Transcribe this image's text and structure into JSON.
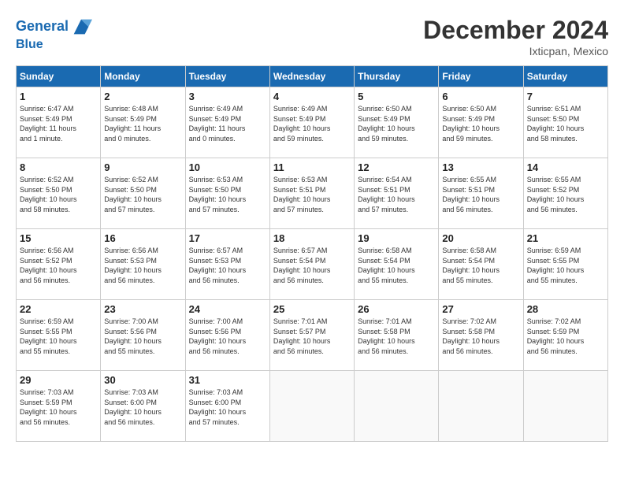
{
  "header": {
    "logo_line1": "General",
    "logo_line2": "Blue",
    "month": "December 2024",
    "location": "Ixticpan, Mexico"
  },
  "days_of_week": [
    "Sunday",
    "Monday",
    "Tuesday",
    "Wednesday",
    "Thursday",
    "Friday",
    "Saturday"
  ],
  "weeks": [
    [
      {
        "day": "1",
        "info": "Sunrise: 6:47 AM\nSunset: 5:49 PM\nDaylight: 11 hours\nand 1 minute."
      },
      {
        "day": "2",
        "info": "Sunrise: 6:48 AM\nSunset: 5:49 PM\nDaylight: 11 hours\nand 0 minutes."
      },
      {
        "day": "3",
        "info": "Sunrise: 6:49 AM\nSunset: 5:49 PM\nDaylight: 11 hours\nand 0 minutes."
      },
      {
        "day": "4",
        "info": "Sunrise: 6:49 AM\nSunset: 5:49 PM\nDaylight: 10 hours\nand 59 minutes."
      },
      {
        "day": "5",
        "info": "Sunrise: 6:50 AM\nSunset: 5:49 PM\nDaylight: 10 hours\nand 59 minutes."
      },
      {
        "day": "6",
        "info": "Sunrise: 6:50 AM\nSunset: 5:49 PM\nDaylight: 10 hours\nand 59 minutes."
      },
      {
        "day": "7",
        "info": "Sunrise: 6:51 AM\nSunset: 5:50 PM\nDaylight: 10 hours\nand 58 minutes."
      }
    ],
    [
      {
        "day": "8",
        "info": "Sunrise: 6:52 AM\nSunset: 5:50 PM\nDaylight: 10 hours\nand 58 minutes."
      },
      {
        "day": "9",
        "info": "Sunrise: 6:52 AM\nSunset: 5:50 PM\nDaylight: 10 hours\nand 57 minutes."
      },
      {
        "day": "10",
        "info": "Sunrise: 6:53 AM\nSunset: 5:50 PM\nDaylight: 10 hours\nand 57 minutes."
      },
      {
        "day": "11",
        "info": "Sunrise: 6:53 AM\nSunset: 5:51 PM\nDaylight: 10 hours\nand 57 minutes."
      },
      {
        "day": "12",
        "info": "Sunrise: 6:54 AM\nSunset: 5:51 PM\nDaylight: 10 hours\nand 57 minutes."
      },
      {
        "day": "13",
        "info": "Sunrise: 6:55 AM\nSunset: 5:51 PM\nDaylight: 10 hours\nand 56 minutes."
      },
      {
        "day": "14",
        "info": "Sunrise: 6:55 AM\nSunset: 5:52 PM\nDaylight: 10 hours\nand 56 minutes."
      }
    ],
    [
      {
        "day": "15",
        "info": "Sunrise: 6:56 AM\nSunset: 5:52 PM\nDaylight: 10 hours\nand 56 minutes."
      },
      {
        "day": "16",
        "info": "Sunrise: 6:56 AM\nSunset: 5:53 PM\nDaylight: 10 hours\nand 56 minutes."
      },
      {
        "day": "17",
        "info": "Sunrise: 6:57 AM\nSunset: 5:53 PM\nDaylight: 10 hours\nand 56 minutes."
      },
      {
        "day": "18",
        "info": "Sunrise: 6:57 AM\nSunset: 5:54 PM\nDaylight: 10 hours\nand 56 minutes."
      },
      {
        "day": "19",
        "info": "Sunrise: 6:58 AM\nSunset: 5:54 PM\nDaylight: 10 hours\nand 55 minutes."
      },
      {
        "day": "20",
        "info": "Sunrise: 6:58 AM\nSunset: 5:54 PM\nDaylight: 10 hours\nand 55 minutes."
      },
      {
        "day": "21",
        "info": "Sunrise: 6:59 AM\nSunset: 5:55 PM\nDaylight: 10 hours\nand 55 minutes."
      }
    ],
    [
      {
        "day": "22",
        "info": "Sunrise: 6:59 AM\nSunset: 5:55 PM\nDaylight: 10 hours\nand 55 minutes."
      },
      {
        "day": "23",
        "info": "Sunrise: 7:00 AM\nSunset: 5:56 PM\nDaylight: 10 hours\nand 55 minutes."
      },
      {
        "day": "24",
        "info": "Sunrise: 7:00 AM\nSunset: 5:56 PM\nDaylight: 10 hours\nand 56 minutes."
      },
      {
        "day": "25",
        "info": "Sunrise: 7:01 AM\nSunset: 5:57 PM\nDaylight: 10 hours\nand 56 minutes."
      },
      {
        "day": "26",
        "info": "Sunrise: 7:01 AM\nSunset: 5:58 PM\nDaylight: 10 hours\nand 56 minutes."
      },
      {
        "day": "27",
        "info": "Sunrise: 7:02 AM\nSunset: 5:58 PM\nDaylight: 10 hours\nand 56 minutes."
      },
      {
        "day": "28",
        "info": "Sunrise: 7:02 AM\nSunset: 5:59 PM\nDaylight: 10 hours\nand 56 minutes."
      }
    ],
    [
      {
        "day": "29",
        "info": "Sunrise: 7:03 AM\nSunset: 5:59 PM\nDaylight: 10 hours\nand 56 minutes."
      },
      {
        "day": "30",
        "info": "Sunrise: 7:03 AM\nSunset: 6:00 PM\nDaylight: 10 hours\nand 56 minutes."
      },
      {
        "day": "31",
        "info": "Sunrise: 7:03 AM\nSunset: 6:00 PM\nDaylight: 10 hours\nand 57 minutes."
      },
      null,
      null,
      null,
      null
    ]
  ]
}
